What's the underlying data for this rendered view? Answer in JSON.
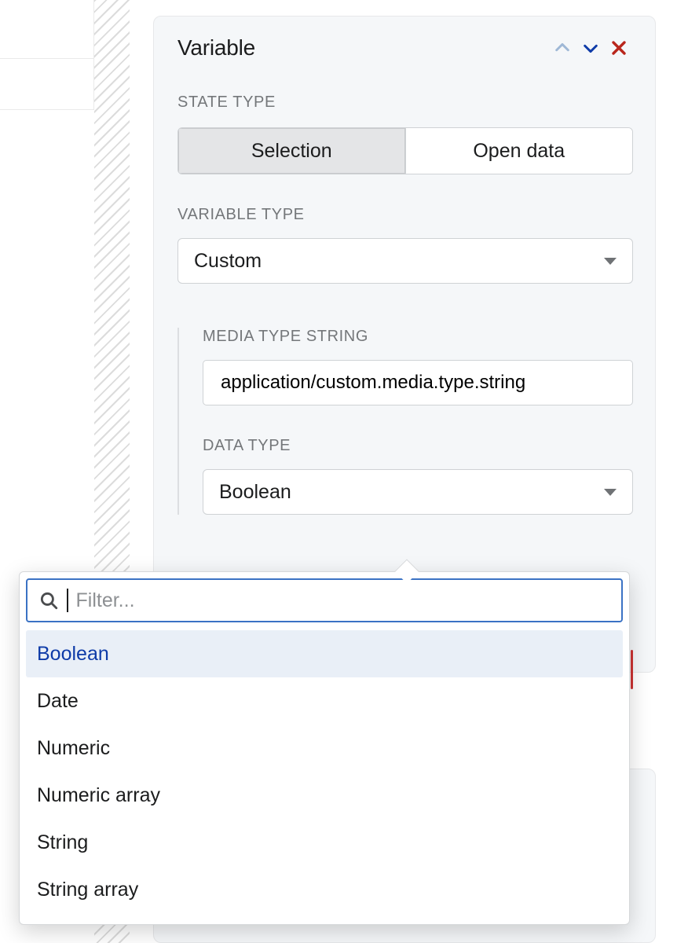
{
  "panel": {
    "title": "Variable",
    "state_type_label": "STATE TYPE",
    "state_type_options": {
      "selection": "Selection",
      "open_data": "Open data"
    },
    "variable_type_label": "VARIABLE TYPE",
    "variable_type_value": "Custom",
    "media_type_label": "MEDIA TYPE STRING",
    "media_type_value": "application/custom.media.type.string",
    "data_type_label": "DATA TYPE",
    "data_type_value": "Boolean"
  },
  "dropdown": {
    "filter_placeholder": "Filter...",
    "options": [
      "Boolean",
      "Date",
      "Numeric",
      "Numeric array",
      "String",
      "String array"
    ],
    "selected_index": 0
  }
}
